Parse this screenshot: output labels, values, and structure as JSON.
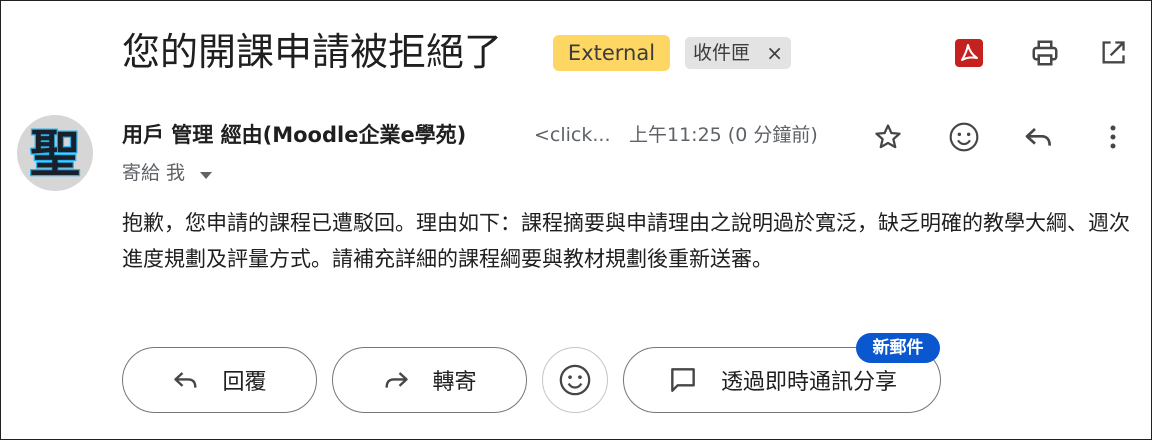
{
  "email": {
    "subject": "您的開課申請被拒絕了",
    "labels": {
      "external": "External",
      "inbox": "收件匣",
      "remove": "×"
    },
    "sender": {
      "name": "用戶 管理 經由(Moodle企業e學苑)",
      "email_truncated": "<click...",
      "avatar_char": "聖",
      "time": "上午11:25 (0 分鐘前)",
      "recipient": "寄給 我"
    },
    "body": "抱歉，您申請的課程已遭駁回。理由如下：課程摘要與申請理由之說明過於寬泛，缺乏明確的教學大綱、週次進度規劃及評量方式。請補充詳細的課程綱要與教材規劃後重新送審。"
  },
  "actions": {
    "reply": "回覆",
    "forward": "轉寄",
    "chat": "透過即時通訊分享",
    "new_badge": "新郵件"
  },
  "icons": [
    "pdf-icon",
    "print-icon",
    "open-in-new-icon",
    "star-icon",
    "emoji-icon",
    "reply-icon",
    "more-vert-icon",
    "chevron-down-icon",
    "forward-icon",
    "chat-icon"
  ],
  "colors": {
    "external_badge": "#fdd663",
    "inbox_badge": "#e3e3e3",
    "new_badge": "#0b57d0",
    "pdf_red": "#c5221f"
  }
}
